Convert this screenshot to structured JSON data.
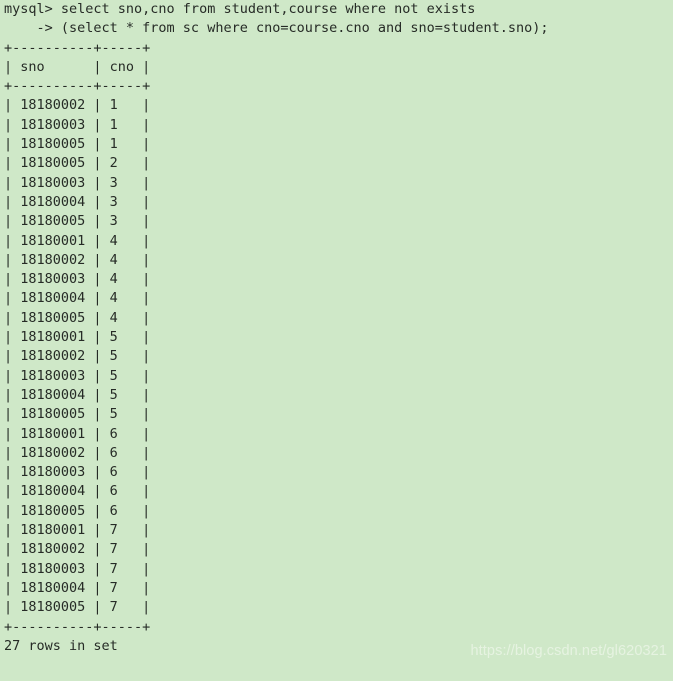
{
  "terminal": {
    "background_color": "#cfe8c8",
    "text_color": "#262b26",
    "prompt": "mysql>",
    "continuation_prompt": "->",
    "query_lines": [
      "mysql> select sno,cno from student,course where not exists",
      "    -> (select * from sc where cno=course.cno and sno=student.sno);"
    ],
    "separator_line": "+----------+-----+",
    "header_line": "| sno      | cno |",
    "columns": [
      "sno",
      "cno"
    ],
    "rows": [
      {
        "sno": "18180002",
        "cno": "1"
      },
      {
        "sno": "18180003",
        "cno": "1"
      },
      {
        "sno": "18180005",
        "cno": "1"
      },
      {
        "sno": "18180005",
        "cno": "2"
      },
      {
        "sno": "18180003",
        "cno": "3"
      },
      {
        "sno": "18180004",
        "cno": "3"
      },
      {
        "sno": "18180005",
        "cno": "3"
      },
      {
        "sno": "18180001",
        "cno": "4"
      },
      {
        "sno": "18180002",
        "cno": "4"
      },
      {
        "sno": "18180003",
        "cno": "4"
      },
      {
        "sno": "18180004",
        "cno": "4"
      },
      {
        "sno": "18180005",
        "cno": "4"
      },
      {
        "sno": "18180001",
        "cno": "5"
      },
      {
        "sno": "18180002",
        "cno": "5"
      },
      {
        "sno": "18180003",
        "cno": "5"
      },
      {
        "sno": "18180004",
        "cno": "5"
      },
      {
        "sno": "18180005",
        "cno": "5"
      },
      {
        "sno": "18180001",
        "cno": "6"
      },
      {
        "sno": "18180002",
        "cno": "6"
      },
      {
        "sno": "18180003",
        "cno": "6"
      },
      {
        "sno": "18180004",
        "cno": "6"
      },
      {
        "sno": "18180005",
        "cno": "6"
      },
      {
        "sno": "18180001",
        "cno": "7"
      },
      {
        "sno": "18180002",
        "cno": "7"
      },
      {
        "sno": "18180003",
        "cno": "7"
      },
      {
        "sno": "18180004",
        "cno": "7"
      },
      {
        "sno": "18180005",
        "cno": "7"
      }
    ],
    "result_summary": "27 rows in set"
  },
  "watermark": {
    "text": "https://blog.csdn.net/gl620321",
    "color": "#e8f4e4"
  }
}
